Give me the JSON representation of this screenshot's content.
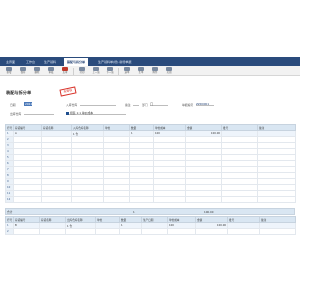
{
  "tabs": [
    "主界面",
    "工作台",
    "生产领料",
    "装配与拆分单",
    "生产领料单(增)-新增单据"
  ],
  "toolbar": [
    "新增",
    "保存",
    "删除",
    "审核",
    "反审",
    "打印",
    "上一张",
    "下一张",
    "选单",
    "生单",
    "附件",
    "关闭"
  ],
  "document": {
    "title": "装配与拆分单",
    "stamp": "未审核"
  },
  "form": {
    "date_label": "日期",
    "date_value": "2024-",
    "in_wh_label": "入库仓库",
    "in_wh_value": "",
    "note_label": "备注",
    "note_value": "",
    "dept_label": "部门",
    "dept_value": "门",
    "doc_no_label": "单据编号",
    "doc_no_value": "ZZD0001",
    "out_wh_label": "出库仓库",
    "out_wh_value": "",
    "mode_label": "",
    "mode_value": "组装 1:1 单价成本"
  },
  "main_table": {
    "headers": [
      "行号",
      "存货编号",
      "存货名称",
      "入库仓库名称",
      "单位",
      "数量",
      "单位成本",
      "金额",
      "批号",
      "备注"
    ],
    "rows": [
      [
        "1",
        "A",
        "",
        "1 仓",
        "",
        "1",
        "100",
        "100.00",
        "",
        ""
      ],
      [
        "2",
        "",
        "",
        "",
        "",
        "",
        "",
        "",
        "",
        ""
      ],
      [
        "3",
        "",
        "",
        "",
        "",
        "",
        "",
        "",
        "",
        ""
      ],
      [
        "4",
        "",
        "",
        "",
        "",
        "",
        "",
        "",
        "",
        ""
      ],
      [
        "5",
        "",
        "",
        "",
        "",
        "",
        "",
        "",
        "",
        ""
      ],
      [
        "6",
        "",
        "",
        "",
        "",
        "",
        "",
        "",
        "",
        ""
      ],
      [
        "7",
        "",
        "",
        "",
        "",
        "",
        "",
        "",
        "",
        ""
      ],
      [
        "8",
        "",
        "",
        "",
        "",
        "",
        "",
        "",
        "",
        ""
      ],
      [
        "9",
        "",
        "",
        "",
        "",
        "",
        "",
        "",
        "",
        ""
      ],
      [
        "10",
        "",
        "",
        "",
        "",
        "",
        "",
        "",
        "",
        ""
      ],
      [
        "11",
        "",
        "",
        "",
        "",
        "",
        "",
        "",
        "",
        ""
      ],
      [
        "12",
        "",
        "",
        "",
        "",
        "",
        "",
        "",
        "",
        ""
      ]
    ],
    "sum_label": "合计",
    "sum_qty": "1",
    "sum_amount": "100.00"
  },
  "sub_table": {
    "headers": [
      "行号",
      "存货编号",
      "存货名称",
      "出库仓库名称",
      "单位",
      "数量",
      "生产日期",
      "单位成本",
      "金额",
      "批号",
      "备注"
    ],
    "rows": [
      [
        "1",
        "B",
        "",
        "1 仓",
        "",
        "1",
        "",
        "100",
        "100.00",
        "",
        ""
      ],
      [
        "2",
        "",
        "",
        "",
        "",
        "",
        "",
        "",
        "",
        "",
        ""
      ]
    ]
  }
}
